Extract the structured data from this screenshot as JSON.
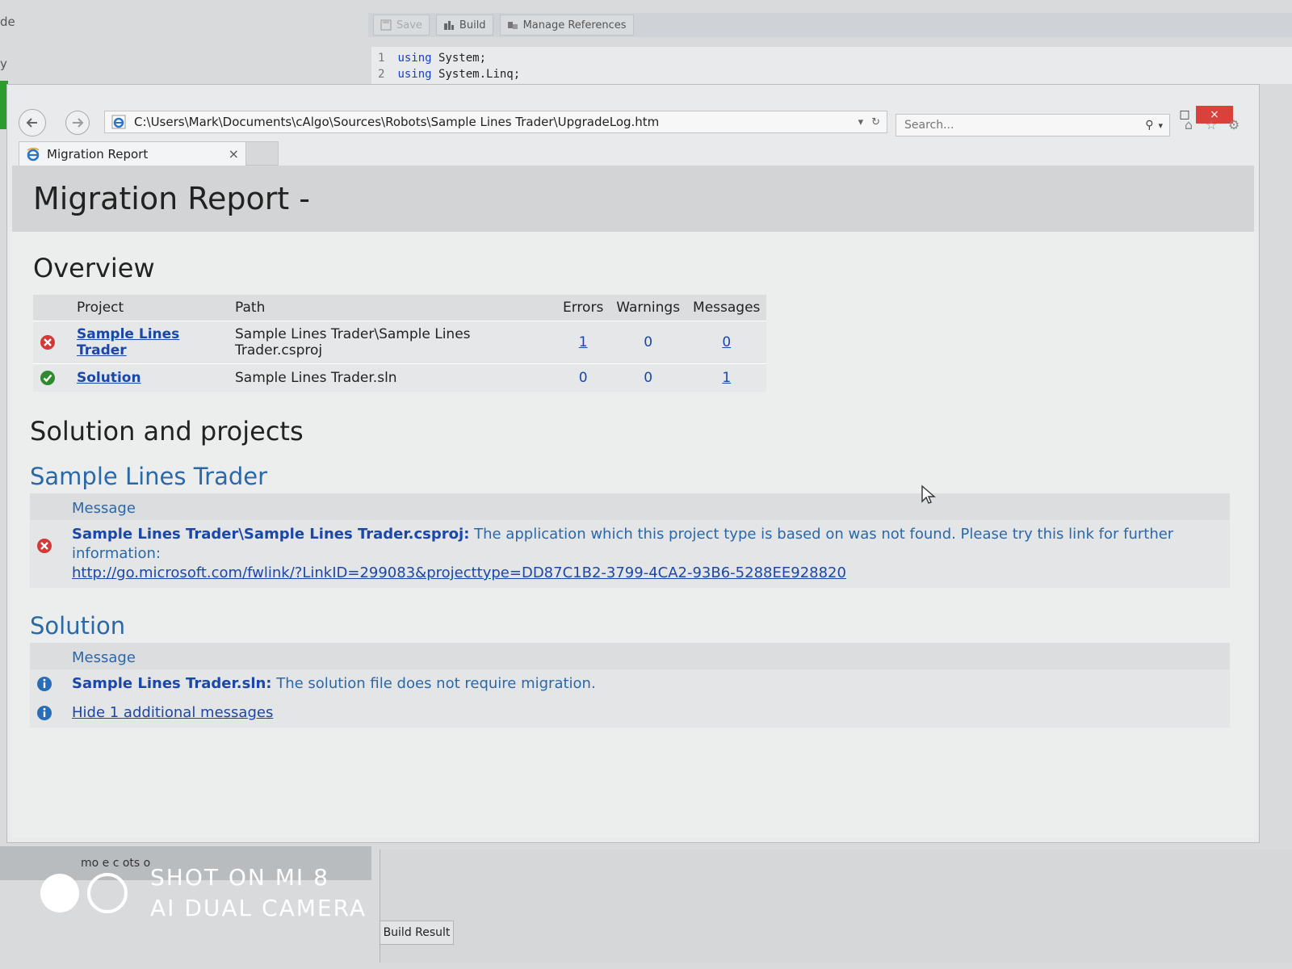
{
  "ide": {
    "left_text_1": "de",
    "left_text_2": "y",
    "toolbar": {
      "save_label": "Save",
      "build_label": "Build",
      "manage_refs_label": "Manage References"
    },
    "code_lines": [
      {
        "num": "1",
        "kw": "using",
        "rest": " System;"
      },
      {
        "num": "2",
        "kw": "using",
        "rest": " System.Linq;"
      }
    ],
    "bottom_left_text": "mo e c ots o",
    "build_result_label": "Build Result"
  },
  "browser": {
    "address": "C:\\Users\\Mark\\Documents\\cAlgo\\Sources\\Robots\\Sample Lines Trader\\UpgradeLog.htm",
    "search_placeholder": "Search...",
    "tab_title": "Migration Report",
    "tab_close": "×",
    "window_controls": {
      "minimize": "–",
      "maximize": "□",
      "close": "×"
    }
  },
  "report": {
    "title": "Migration Report -",
    "overview_heading": "Overview",
    "overview_columns": {
      "project": "Project",
      "path": "Path",
      "errors": "Errors",
      "warnings": "Warnings",
      "messages": "Messages"
    },
    "overview_rows": [
      {
        "status": "error",
        "project": "Sample Lines Trader",
        "path": "Sample Lines Trader\\Sample Lines Trader.csproj",
        "errors": "1",
        "warnings": "0",
        "messages": "0"
      },
      {
        "status": "ok",
        "project": "Solution",
        "path": "Sample Lines Trader.sln",
        "errors": "0",
        "warnings": "0",
        "messages": "1"
      }
    ],
    "solution_heading": "Solution and projects",
    "project_section": {
      "title": "Sample Lines Trader",
      "message_header": "Message",
      "message_bold": "Sample Lines Trader\\Sample Lines Trader.csproj:",
      "message_text": " The application which this project type is based on was not found. Please try this link for further information:",
      "message_link": "http://go.microsoft.com/fwlink/?LinkID=299083&projecttype=DD87C1B2-3799-4CA2-93B6-5288EE928820"
    },
    "solution_section": {
      "title": "Solution",
      "message_header": "Message",
      "message_bold": "Sample Lines Trader.sln:",
      "message_text": " The solution file does not require migration.",
      "hide_link": "Hide 1 additional messages"
    }
  },
  "watermark": {
    "line1": "SHOT ON MI 8",
    "line2": "AI DUAL CAMERA"
  },
  "colors": {
    "link": "#1a47a8",
    "section_blue": "#2b68a8",
    "error_red": "#d23a3a",
    "ok_green": "#2e8b2e",
    "info_blue": "#2a6db5",
    "close_red": "#d9413a"
  }
}
